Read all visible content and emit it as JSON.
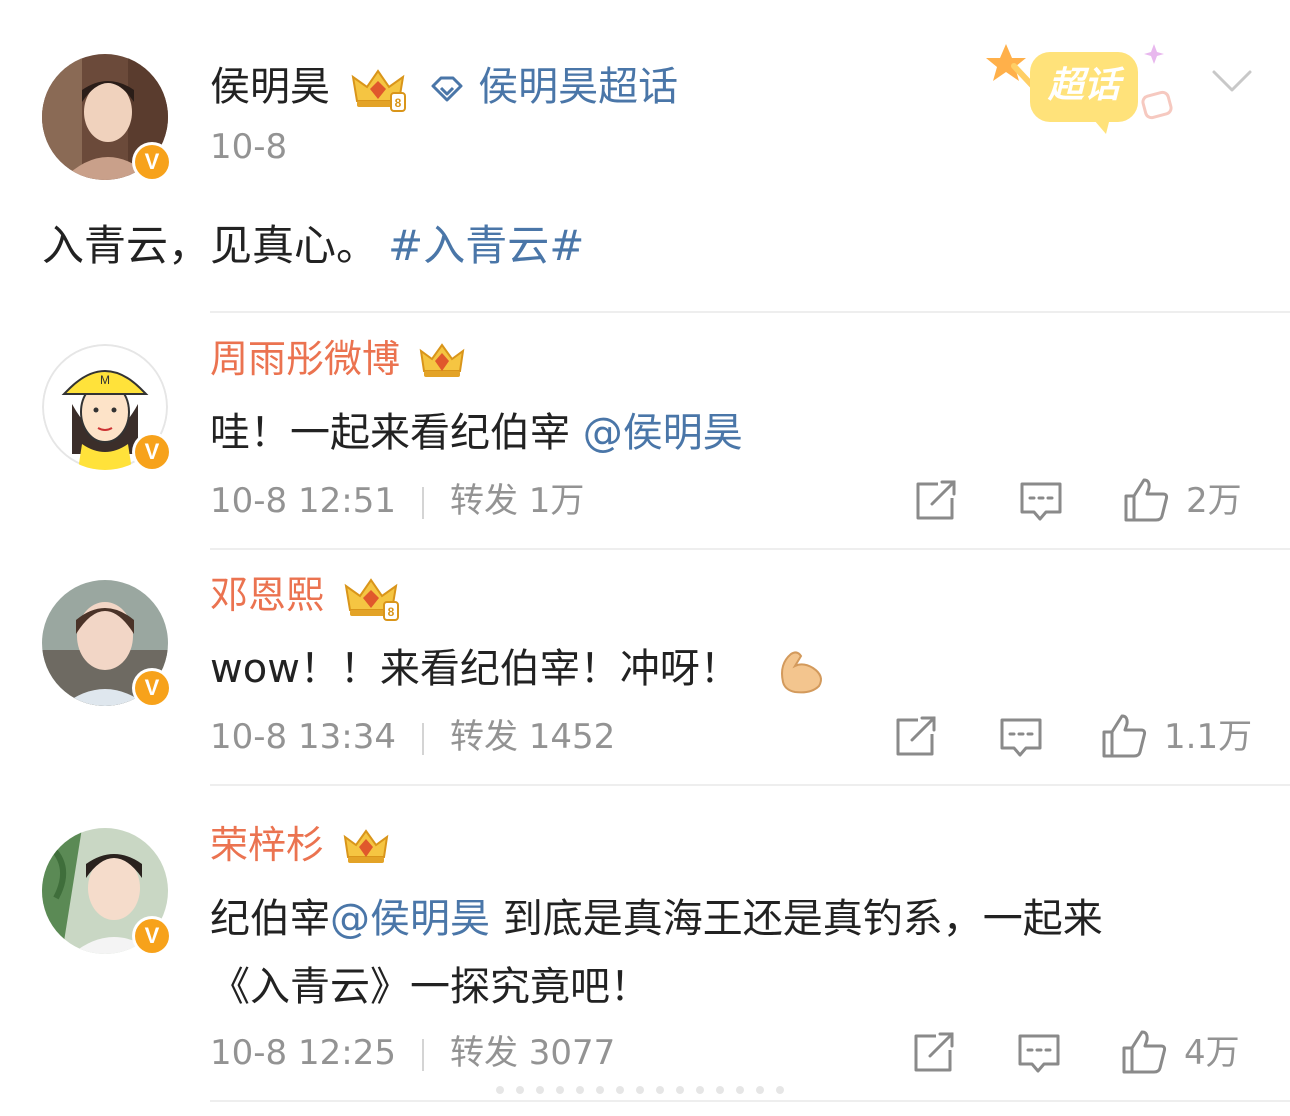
{
  "post": {
    "author": "侯明昊",
    "supertopic_label": "侯明昊超话",
    "date": "10-8",
    "text_plain": "入青云，见真心。",
    "hashtag": "#入青云#",
    "badge_label": "超话"
  },
  "comments": [
    {
      "name": "周雨彤微博",
      "text": "哇！一起来看纪伯宰 ",
      "mention": "@侯明昊",
      "time": "10-8 12:51",
      "repost_label": "转发",
      "repost_count": "1万",
      "like_count": "2万"
    },
    {
      "name": "邓恩熙",
      "text": "wow！！来看纪伯宰！冲呀！",
      "emoji": "muscle-emoji",
      "time": "10-8 13:34",
      "repost_label": "转发",
      "repost_count": "1452",
      "like_count": "1.1万"
    },
    {
      "name": "荣梓杉",
      "text_prefix": "纪伯宰",
      "mention": "@侯明昊",
      "text_suffix": " 到底是真海王还是真钓系，一起来",
      "text_line2": "《入青云》一探究竟吧！",
      "time": "10-8 12:25",
      "repost_label": "转发",
      "repost_count": "3077",
      "like_count": "4万"
    }
  ],
  "colors": {
    "link_blue": "#4a76a8",
    "name_orange": "#eb7350",
    "meta_gray": "#939393",
    "verified_orange": "#f7a21b"
  }
}
